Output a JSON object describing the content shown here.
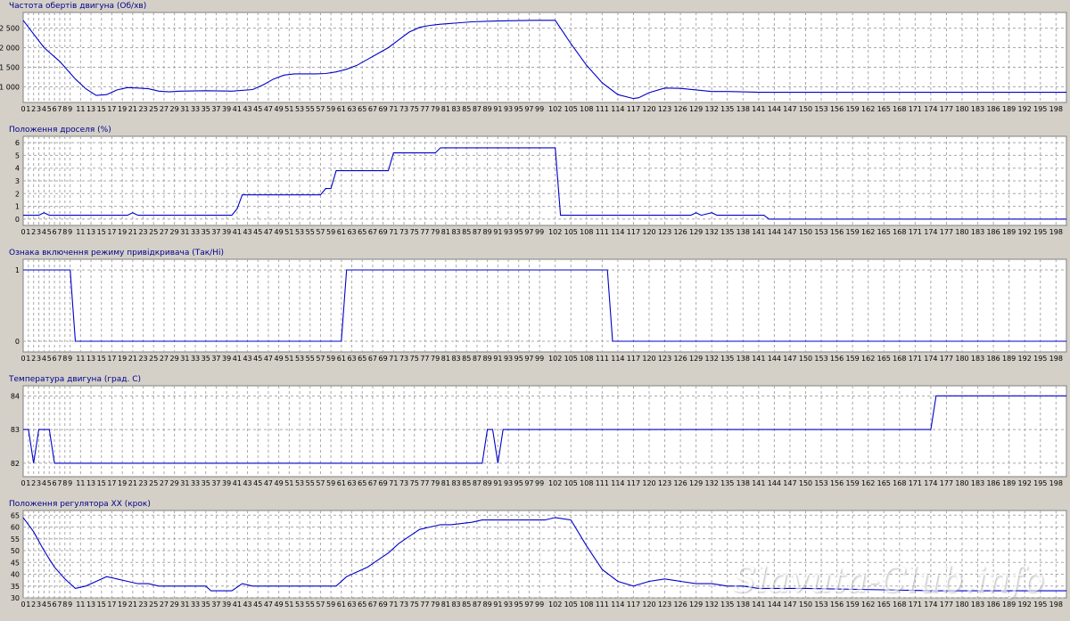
{
  "watermark": "Slavuta-Club.info",
  "colors": {
    "line": "#0000cc",
    "background": "#d4d0c8",
    "plot_bg": "#ffffff",
    "grid": "#a8a8a8",
    "text": "#000000",
    "title": "#00008b"
  },
  "x_tick_labels": [
    "0",
    "1",
    "2",
    "3",
    "4",
    "5",
    "6",
    "7",
    "8",
    "9",
    "11",
    "13",
    "15",
    "17",
    "19",
    "21",
    "23",
    "25",
    "27",
    "29",
    "31",
    "33",
    "35",
    "37",
    "39",
    "41",
    "43",
    "45",
    "47",
    "49",
    "51",
    "53",
    "55",
    "57",
    "59",
    "61",
    "63",
    "65",
    "67",
    "69",
    "71",
    "73",
    "75",
    "77",
    "79",
    "81",
    "83",
    "85",
    "87",
    "89",
    "91",
    "93",
    "95",
    "97",
    "99",
    "102",
    "105",
    "108",
    "111",
    "114",
    "117",
    "120",
    "123",
    "126",
    "129",
    "132",
    "135",
    "138",
    "141",
    "144",
    "147",
    "150",
    "153",
    "156",
    "159",
    "162",
    "165",
    "168",
    "171",
    "174",
    "177",
    "180",
    "183",
    "186",
    "189",
    "192",
    "195",
    "198"
  ],
  "chart_data": [
    {
      "type": "line",
      "title": "Частота обертів двигуна (Об/хв)",
      "ylim": [
        600,
        2900
      ],
      "yticks": [
        1000,
        1500,
        2000,
        2500
      ],
      "ytick_labels": [
        "1 000",
        "1 500",
        "2 000",
        "2 500"
      ],
      "x": [
        0,
        2,
        4,
        7,
        10,
        12,
        14,
        16,
        18,
        20,
        22,
        24,
        26,
        28,
        30,
        35,
        40,
        44,
        46,
        48,
        50,
        52,
        54,
        56,
        58,
        60,
        62,
        64,
        66,
        68,
        70,
        72,
        74,
        76,
        78,
        80,
        82,
        86,
        90,
        94,
        98,
        100,
        102,
        105,
        108,
        111,
        114,
        117,
        118,
        120,
        123,
        126,
        129,
        132,
        135,
        138,
        141,
        200
      ],
      "values": [
        2700,
        2350,
        2000,
        1650,
        1200,
        950,
        780,
        800,
        920,
        980,
        970,
        950,
        890,
        870,
        890,
        900,
        890,
        930,
        1050,
        1200,
        1300,
        1330,
        1330,
        1330,
        1340,
        1380,
        1450,
        1550,
        1700,
        1850,
        2000,
        2200,
        2400,
        2520,
        2570,
        2600,
        2620,
        2660,
        2680,
        2690,
        2700,
        2700,
        2700,
        2100,
        1550,
        1100,
        800,
        700,
        720,
        850,
        970,
        960,
        920,
        880,
        880,
        870,
        860,
        860
      ]
    },
    {
      "type": "line",
      "title": "Положення дроселя (%)",
      "ylim": [
        -0.5,
        6.5
      ],
      "yticks": [
        0,
        1,
        2,
        3,
        4,
        5,
        6
      ],
      "ytick_labels": [
        "0",
        "1",
        "2",
        "3",
        "4",
        "5",
        "6"
      ],
      "x": [
        0,
        3,
        4,
        5,
        20,
        21,
        22,
        40,
        41,
        42,
        57,
        58,
        59,
        60,
        61,
        70,
        71,
        79,
        80,
        101,
        102,
        103,
        128,
        129,
        130,
        132,
        133,
        134,
        142,
        143,
        200
      ],
      "values": [
        0.3,
        0.3,
        0.5,
        0.3,
        0.3,
        0.5,
        0.3,
        0.3,
        0.8,
        1.9,
        1.9,
        2.4,
        2.4,
        3.8,
        3.8,
        3.8,
        5.2,
        5.2,
        5.6,
        5.6,
        5.6,
        0.3,
        0.3,
        0.5,
        0.3,
        0.5,
        0.3,
        0.3,
        0.3,
        0.0,
        0.0
      ]
    },
    {
      "type": "line",
      "title": "Ознака включення режиму привідкривача (Так/Ні)",
      "ylim": [
        -0.15,
        1.15
      ],
      "yticks": [
        0,
        1
      ],
      "ytick_labels": [
        "0",
        "1"
      ],
      "x": [
        0,
        9,
        10,
        61,
        62,
        112,
        113,
        200
      ],
      "values": [
        1,
        1,
        0,
        0,
        1,
        1,
        0,
        0
      ]
    },
    {
      "type": "line",
      "title": "Температура двигуна (град. С)",
      "ylim": [
        81.6,
        84.3
      ],
      "yticks": [
        82,
        83,
        84
      ],
      "ytick_labels": [
        "82",
        "83",
        "84"
      ],
      "x": [
        0,
        1,
        2,
        3,
        4,
        5,
        6,
        88,
        89,
        90,
        91,
        92,
        174,
        175,
        200
      ],
      "values": [
        83,
        83,
        82,
        83,
        83,
        83,
        82,
        82,
        83,
        83,
        82,
        83,
        83,
        84,
        84
      ]
    },
    {
      "type": "line",
      "title": "Положення регулятора ХХ (крок)",
      "ylim": [
        30,
        67
      ],
      "yticks": [
        30,
        35,
        40,
        45,
        50,
        55,
        60,
        65
      ],
      "ytick_labels": [
        "30",
        "35",
        "40",
        "45",
        "50",
        "55",
        "60",
        "65"
      ],
      "x": [
        0,
        2,
        4,
        6,
        8,
        10,
        12,
        14,
        16,
        18,
        20,
        22,
        24,
        26,
        28,
        30,
        35,
        36,
        38,
        40,
        42,
        44,
        46,
        60,
        62,
        64,
        66,
        68,
        70,
        72,
        74,
        76,
        78,
        80,
        82,
        86,
        88,
        92,
        96,
        100,
        102,
        105,
        108,
        111,
        114,
        117,
        120,
        123,
        126,
        129,
        132,
        135,
        138,
        141,
        150,
        175,
        200
      ],
      "values": [
        64,
        58,
        50,
        43,
        38,
        34,
        35,
        37,
        39,
        38,
        37,
        36,
        36,
        35,
        35,
        35,
        35,
        33,
        33,
        33,
        36,
        35,
        35,
        35,
        39,
        41,
        43,
        46,
        49,
        53,
        56,
        59,
        60,
        61,
        61,
        62,
        63,
        63,
        63,
        63,
        64,
        63,
        52,
        42,
        37,
        35,
        37,
        38,
        37,
        36,
        36,
        35,
        35,
        34,
        34,
        33,
        33
      ]
    }
  ]
}
